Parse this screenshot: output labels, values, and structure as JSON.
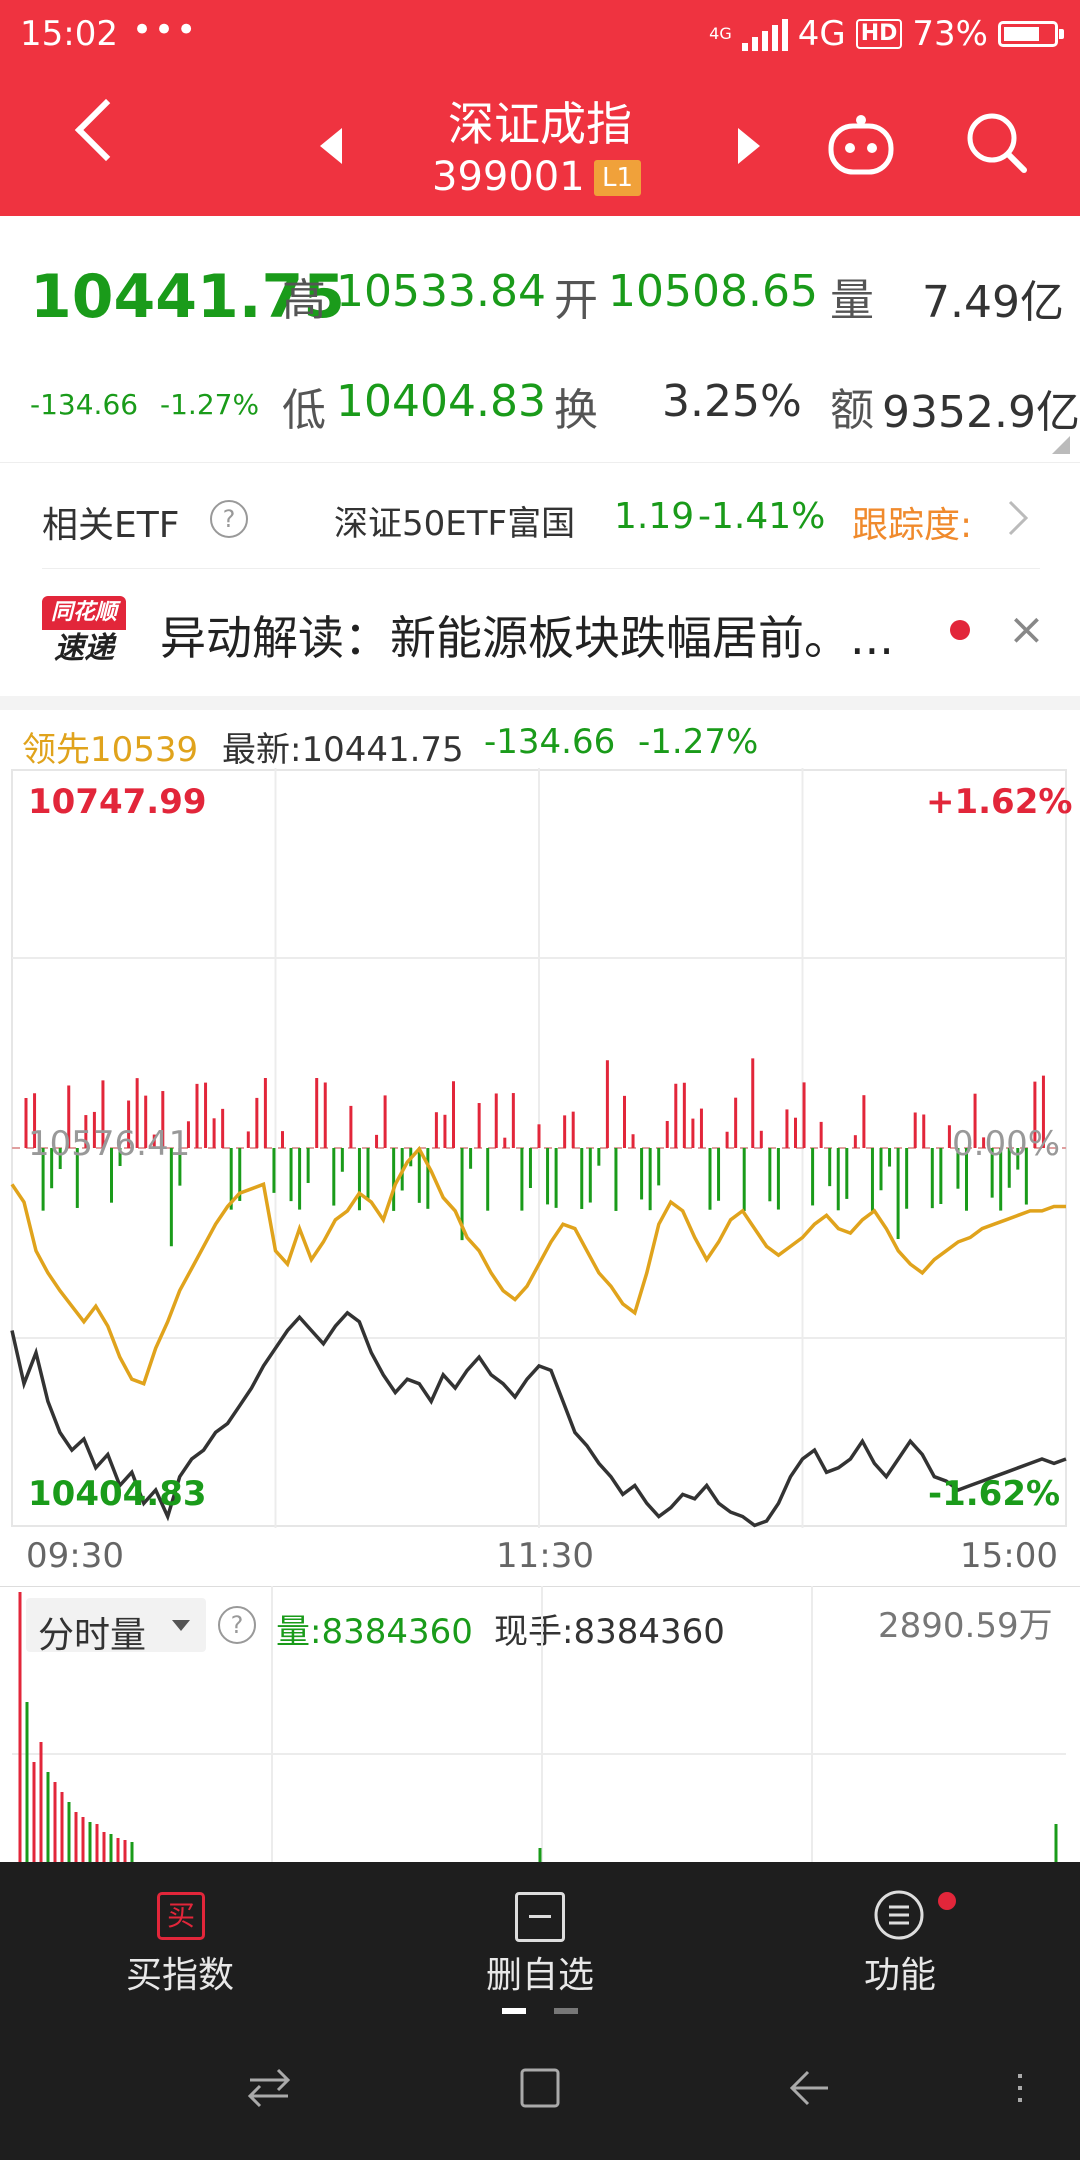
{
  "status_bar": {
    "time": "15:02",
    "dots": "•••",
    "net_small": "4G",
    "net": "4G",
    "hd": "HD",
    "battery": "73%",
    "battery_level": 0.73
  },
  "header": {
    "title": "深证成指",
    "code": "399001",
    "level": "L1"
  },
  "quote": {
    "price": "10441.75",
    "change": "-134.66",
    "change_pct": "-1.27%",
    "high_label": "高",
    "high": "10533.84",
    "open_label": "开",
    "open": "10508.65",
    "vol_label": "量",
    "vol": "7.49亿",
    "low_label": "低",
    "low": "10404.83",
    "turnover_label": "换",
    "turnover": "3.25%",
    "amount_label": "额",
    "amount": "9352.9亿"
  },
  "etf": {
    "label": "相关ETF",
    "help": "?",
    "name": "深证50ETF富国",
    "price": "1.19",
    "pct": "-1.41%",
    "track_label": "跟踪度:"
  },
  "news": {
    "logo_top": "同花顺",
    "logo_bottom": "速递",
    "text": "异动解读：新能源板块跌幅居前。...",
    "close": "×"
  },
  "chart_header": {
    "lead": "领先10539",
    "latest": "最新:10441.75",
    "change": "-134.66",
    "pct": "-1.27%"
  },
  "chart_data": {
    "type": "line",
    "max_label": "10747.99",
    "max_pct": "+1.62%",
    "mid_label": "10576.41",
    "mid_pct": "0.00%",
    "min_label": "10404.83",
    "min_pct": "-1.62%",
    "ylim": [
      10404.83,
      10747.99
    ],
    "x_labels": [
      "09:30",
      "11:30",
      "15:00"
    ],
    "series": [
      {
        "color": "#333333",
        "values": [
          10494,
          10470,
          10484,
          10462,
          10448,
          10440,
          10445,
          10432,
          10438,
          10424,
          10430,
          10416,
          10422,
          10410,
          10428,
          10436,
          10440,
          10448,
          10452,
          10460,
          10468,
          10478,
          10486,
          10494,
          10500,
          10494,
          10488,
          10496,
          10502,
          10498,
          10484,
          10474,
          10466,
          10472,
          10470,
          10462,
          10474,
          10468,
          10476,
          10482,
          10474,
          10470,
          10464,
          10472,
          10478,
          10476,
          10462,
          10448,
          10442,
          10434,
          10428,
          10420,
          10424,
          10416,
          10410,
          10414,
          10420,
          10418,
          10424,
          10416,
          10412,
          10410,
          10406,
          10408,
          10416,
          10428,
          10436,
          10440,
          10430,
          10432,
          10436,
          10444,
          10434,
          10428,
          10436,
          10444,
          10438,
          10428,
          10426,
          10422,
          10424,
          10426,
          10428,
          10430,
          10432,
          10434,
          10436,
          10434,
          10436
        ]
      },
      {
        "color": "#e0a31c",
        "values": [
          10560,
          10552,
          10530,
          10520,
          10512,
          10505,
          10498,
          10505,
          10496,
          10482,
          10472,
          10470,
          10486,
          10498,
          10512,
          10522,
          10532,
          10542,
          10550,
          10556,
          10558,
          10560,
          10530,
          10524,
          10540,
          10526,
          10534,
          10544,
          10548,
          10556,
          10552,
          10544,
          10560,
          10570,
          10576,
          10566,
          10554,
          10548,
          10536,
          10530,
          10520,
          10512,
          10508,
          10514,
          10524,
          10534,
          10542,
          10540,
          10530,
          10520,
          10514,
          10506,
          10502,
          10520,
          10542,
          10552,
          10548,
          10536,
          10526,
          10534,
          10544,
          10548,
          10540,
          10532,
          10528,
          10532,
          10536,
          10542,
          10546,
          10540,
          10538,
          10544,
          10548,
          10540,
          10530,
          10524,
          10520,
          10526,
          10530,
          10534,
          10536,
          10540,
          10542,
          10544,
          10546,
          10548,
          10548,
          10550,
          10550
        ]
      }
    ],
    "vol_bar_label": "分时量",
    "vol_help": "?",
    "vol_text": "量:8384360",
    "hand_text": "现手:8384360",
    "vol_max": "2890.59万"
  },
  "bottom_nav": {
    "buy_icon": "买",
    "buy_label": "买指数",
    "del_label": "删自选",
    "func_label": "功能"
  },
  "colors": {
    "header": "#ef3340",
    "up": "#e2263a",
    "down": "#1a9b1a",
    "avg": "#e0a31c"
  },
  "icons": [
    "back-arrow-icon",
    "prev-stock-icon",
    "next-stock-icon",
    "robot-icon",
    "search-icon",
    "help-icon",
    "chevron-right-icon",
    "close-icon",
    "buy-icon",
    "remove-watch-icon",
    "function-menu-icon",
    "switch-icon",
    "home-icon",
    "back-icon",
    "menu-icon"
  ]
}
